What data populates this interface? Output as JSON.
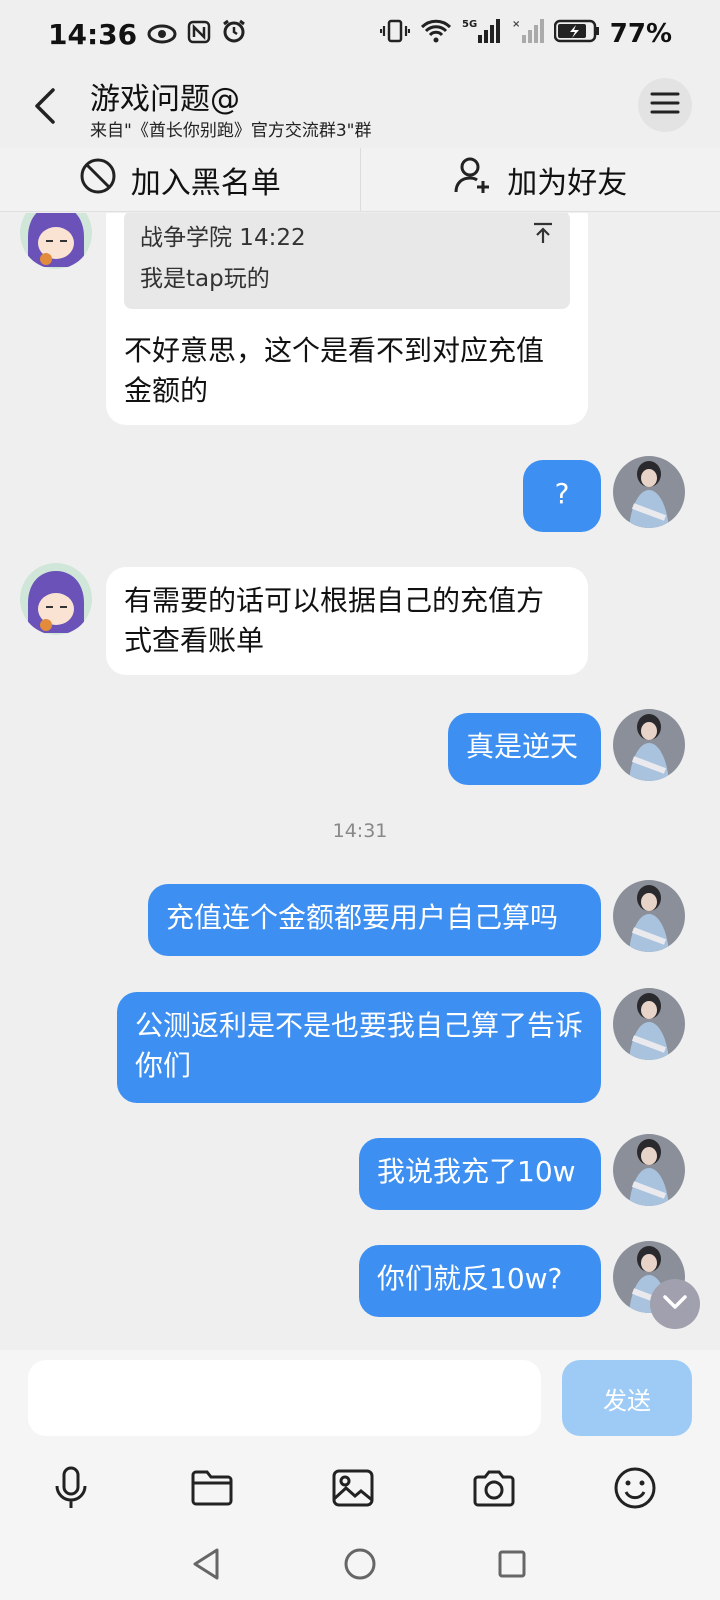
{
  "status_bar": {
    "time": "14:36",
    "battery": "77%",
    "network": "5G"
  },
  "header": {
    "title": "游戏问题@",
    "subtitle": "来自\"《酋长你别跑》官方交流群3\"群"
  },
  "actions": {
    "block_label": "加入黑名单",
    "add_friend_label": "加为好友"
  },
  "chat": {
    "messages": [
      {
        "quote_sender": "战争学院 14:22",
        "quote_text": "我是tap玩的",
        "text": "不好意思，这个是看不到对应充值金额的"
      },
      {
        "text": "?"
      },
      {
        "text": "有需要的话可以根据自己的充值方式查看账单"
      },
      {
        "text": "真是逆天"
      },
      {
        "text": "充值连个金额都要用户自己算吗"
      },
      {
        "text": "公测返利是不是也要我自己算了告诉你们"
      },
      {
        "text": "我说我充了10w"
      },
      {
        "text": "你们就反10w?"
      }
    ],
    "timestamp": "14:31"
  },
  "composer": {
    "placeholder": "",
    "send_label": "发送"
  },
  "colors": {
    "outgoing_bubble": "#3d8ff2",
    "send_button": "#9ecbf6",
    "background": "#efefef"
  },
  "icons": {
    "back": "chevron-left-icon",
    "menu": "hamburger-icon",
    "block": "prohibited-icon",
    "add_friend": "person-add-icon",
    "quote_pin": "arrow-up-icon",
    "voice": "microphone-icon",
    "file": "folder-icon",
    "image": "image-icon",
    "camera": "camera-icon",
    "emoji": "smiley-icon"
  }
}
